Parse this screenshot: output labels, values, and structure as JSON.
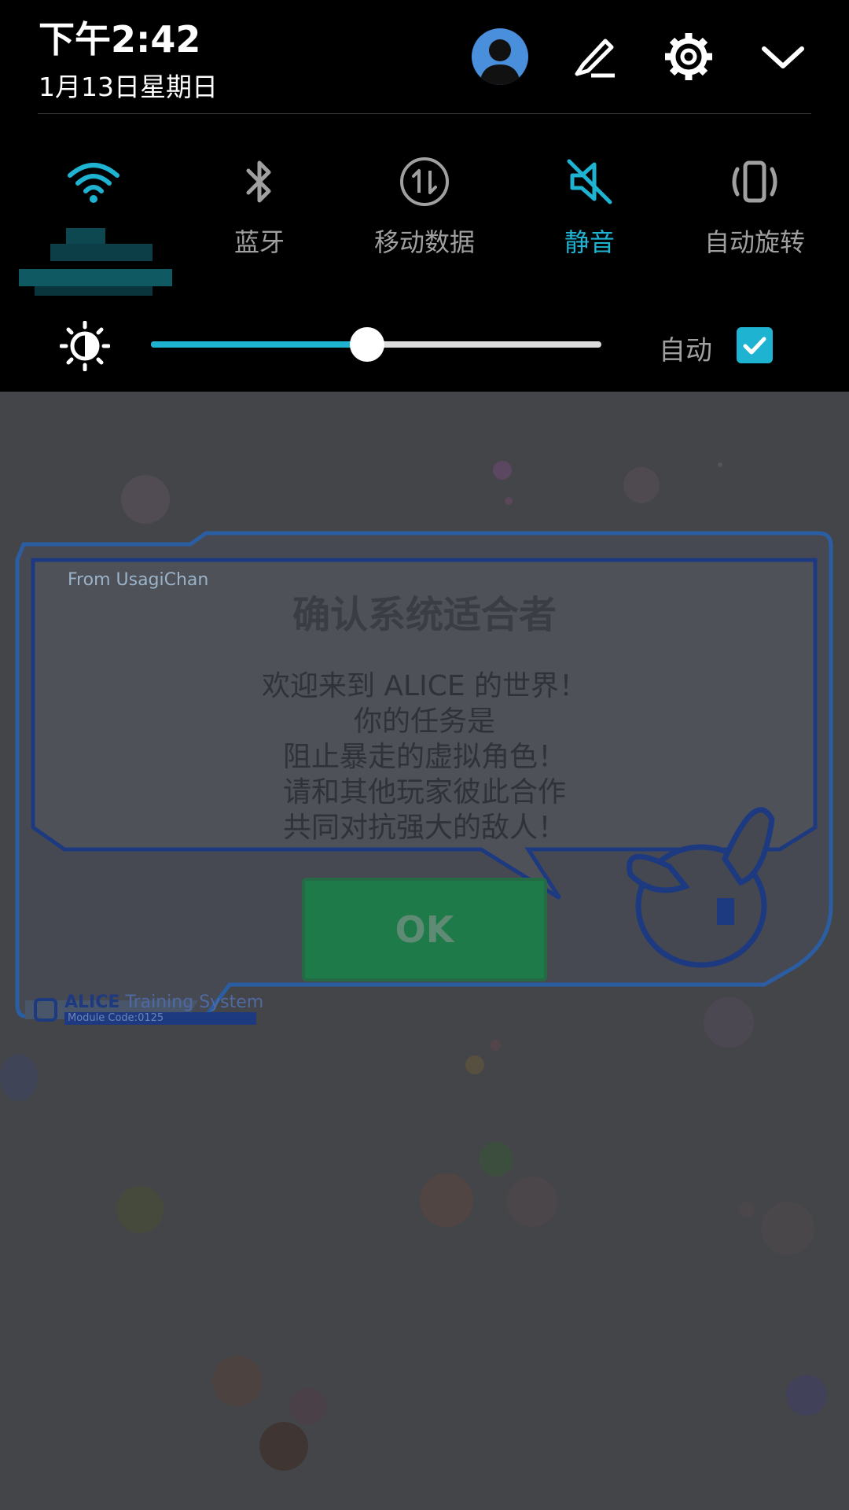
{
  "status_header": {
    "time": "下午2:42",
    "date": "1月13日星期日"
  },
  "quick_settings": {
    "tiles": [
      {
        "id": "wifi",
        "label": "",
        "active": true,
        "icon": "wifi-icon"
      },
      {
        "id": "bluetooth",
        "label": "蓝牙",
        "active": false,
        "icon": "bluetooth-icon"
      },
      {
        "id": "mobile_data",
        "label": "移动数据",
        "active": false,
        "icon": "mobile-data-icon"
      },
      {
        "id": "mute",
        "label": "静音",
        "active": true,
        "icon": "mute-icon"
      },
      {
        "id": "auto_rotate",
        "label": "自动旋转",
        "active": false,
        "icon": "auto-rotate-icon"
      }
    ],
    "brightness": {
      "level": 0.48,
      "auto_label": "自动",
      "auto_checked": true
    }
  },
  "dialog": {
    "from_tag": "From UsagiChan",
    "title": "确认系统适合者",
    "lines": [
      "欢迎来到 ALICE 的世界！",
      "你的任务是",
      "阻止暴走的虚拟角色！",
      "请和其他玩家彼此合作",
      "共同对抗强大的敌人！"
    ],
    "ok_label": "OK",
    "system_name_bold": "ALICE",
    "system_name_rest": " Training System",
    "module_code": "Module Code:0125"
  },
  "colors": {
    "accent": "#1fb3d2",
    "shade_bg": "#000000",
    "ok_green": "#1e7a48",
    "dialog_blue": "#1d3a80"
  }
}
